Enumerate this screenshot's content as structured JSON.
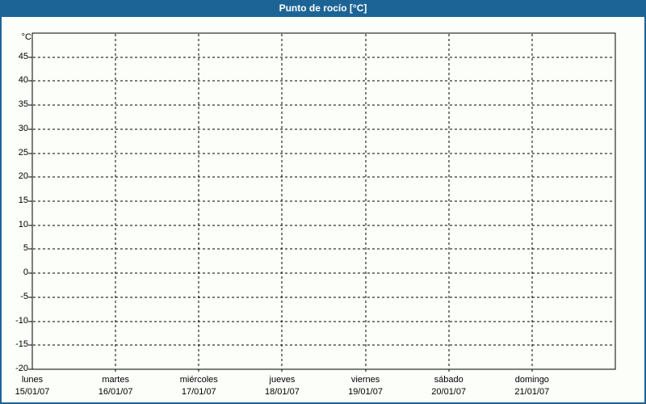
{
  "window": {
    "title": "Punto de rocío [°C]"
  },
  "colors": {
    "titlebar_bg": "#1d6496",
    "titlebar_text": "#ffffff",
    "frame_border": "#1d6496",
    "background": "#fcfef9",
    "grid": "#000000",
    "axis": "#000000",
    "label_text": "#000000"
  },
  "chart_data": {
    "type": "line",
    "title": "Punto de rocío [°C]",
    "y_unit_label": "°C",
    "ylim": [
      -20,
      50
    ],
    "y_ticks": [
      45,
      40,
      35,
      30,
      25,
      20,
      15,
      10,
      5,
      0,
      -5,
      -10,
      -15,
      -20
    ],
    "x_categories": [
      {
        "day": "lunes",
        "date": "15/01/07"
      },
      {
        "day": "martes",
        "date": "16/01/07"
      },
      {
        "day": "miércoles",
        "date": "17/01/07"
      },
      {
        "day": "jueves",
        "date": "18/01/07"
      },
      {
        "day": "viernes",
        "date": "19/01/07"
      },
      {
        "day": "sábado",
        "date": "20/01/07"
      },
      {
        "day": "domingo",
        "date": "21/01/07"
      }
    ],
    "series": [],
    "grid": "dashed",
    "legend_position": "none"
  }
}
